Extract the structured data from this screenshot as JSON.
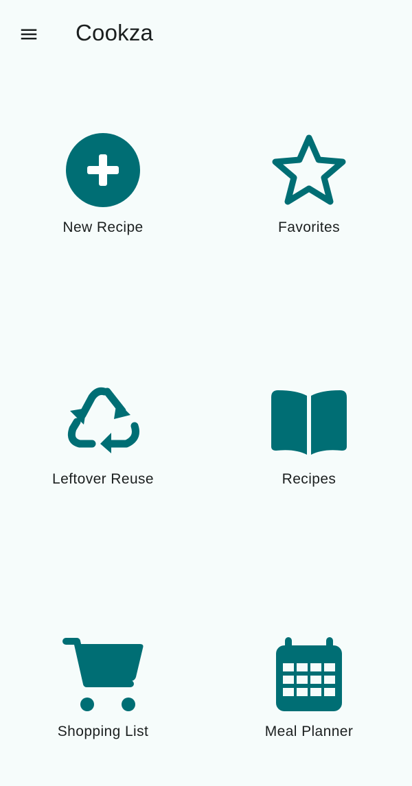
{
  "app_bar": {
    "title": "Cookza",
    "menu_icon": "hamburger-menu-icon"
  },
  "colors": {
    "accent": "#006e74",
    "background": "#f6fcfb",
    "text": "#1b1f1f"
  },
  "grid": {
    "items": [
      {
        "label": "New Recipe",
        "icon": "add-circle-icon"
      },
      {
        "label": "Favorites",
        "icon": "star-outline-icon"
      },
      {
        "label": "Leftover Reuse",
        "icon": "recycle-icon"
      },
      {
        "label": "Recipes",
        "icon": "open-book-icon"
      },
      {
        "label": "Shopping List",
        "icon": "shopping-cart-icon"
      },
      {
        "label": "Meal Planner",
        "icon": "calendar-icon"
      }
    ]
  }
}
